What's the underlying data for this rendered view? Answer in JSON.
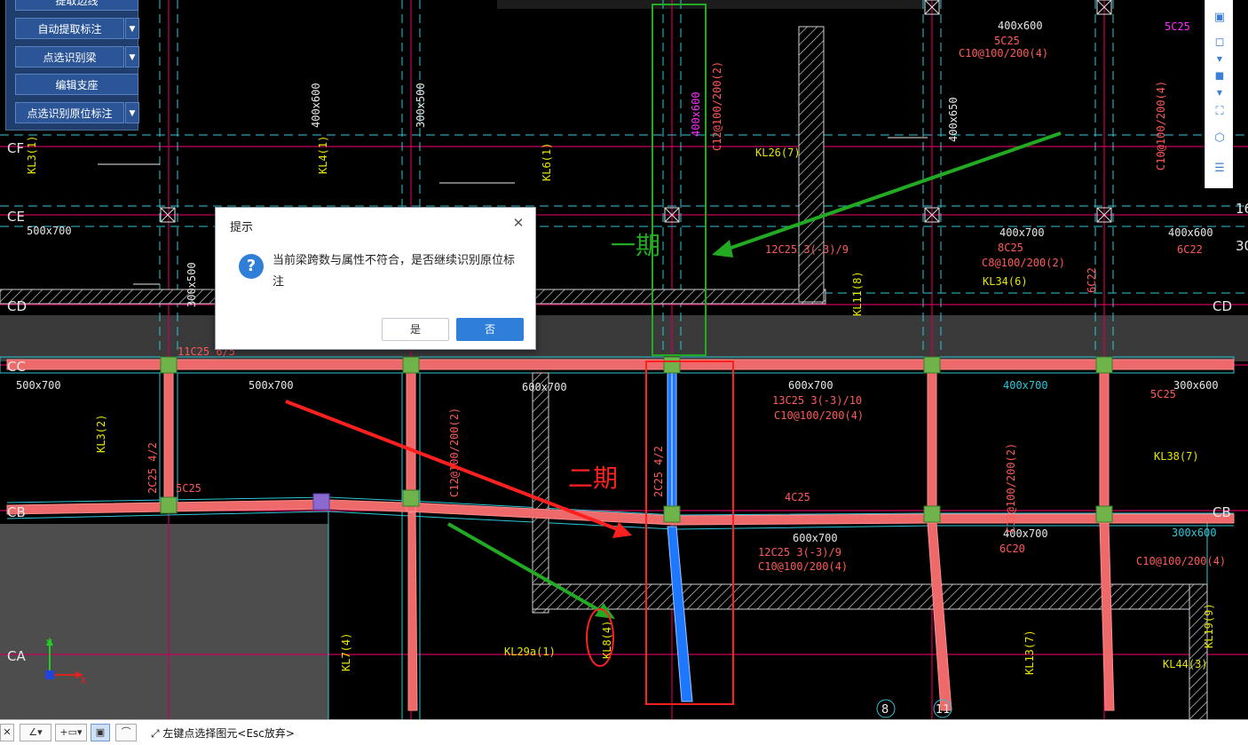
{
  "left_panel": {
    "buttons": [
      {
        "label": "提取边线",
        "has_dropdown": false
      },
      {
        "label": "自动提取标注",
        "has_dropdown": true
      },
      {
        "label": "点选识别梁",
        "has_dropdown": true
      },
      {
        "label": "编辑支座",
        "has_dropdown": false
      },
      {
        "label": "点选识别原位标注",
        "has_dropdown": true
      }
    ]
  },
  "dialog": {
    "title": "提示",
    "close_icon": "close-icon",
    "icon": "question-icon",
    "message": "当前梁跨数与属性不符合，是否继续识别原位标注",
    "yes_label": "是",
    "no_label": "否"
  },
  "annotations": {
    "phase1": "一期",
    "phase2": "二期"
  },
  "axes": {
    "rows": [
      "CF",
      "CE",
      "CD",
      "CC",
      "CB",
      "CA"
    ],
    "right_rows": [
      "CD",
      "CB"
    ],
    "columns": [
      "8",
      "11"
    ],
    "right_edge_marks": [
      "16",
      "30"
    ]
  },
  "drawing_labels": {
    "beam_tags": [
      "KL3(1)",
      "KL4(1)",
      "KL6(1)",
      "KL26(7)",
      "KL34(6)",
      "KL11(8)",
      "KL3(2)",
      "KL38(7)",
      "KL7(4)",
      "KL29a(1)",
      "KL8(4)",
      "KL13(7)",
      "KL44(3)",
      "KL19(9)"
    ],
    "sizes": [
      "400x600",
      "500x700",
      "300x500",
      "600x700",
      "400x700",
      "300x600",
      "400x650"
    ],
    "rebar": [
      "C10@100/200(4)",
      "C8@100/200(2)",
      "5C25",
      "8C25",
      "2C25 4/2",
      "6C22",
      "4C25",
      "6C20",
      "12C25 3(-3)/9",
      "13C25 3(-3)/10",
      "C12@100/200(2)",
      "11C25 6/5"
    ]
  },
  "ucs": {
    "x": "X",
    "y": "Y"
  },
  "right_toolbar": {
    "icons": [
      "view-3d-icon",
      "cube-icon",
      "cube-solid-icon",
      "fit-view-icon",
      "layers-cube-icon",
      "properties-icon"
    ]
  },
  "bottom_toolbar": {
    "status_text": "左键点选择图元<Esc放弃>",
    "icons": [
      "close-small-icon",
      "angle-icon",
      "dimension-icon",
      "screen-icon",
      "curve-icon",
      "expand-icon"
    ]
  },
  "colors": {
    "background": "#000000",
    "axis_line": "#c8005a",
    "grid_cyan": "#2ec7d9",
    "beam_fill": "#ee6a6a",
    "selected_beam": "#1e78ff",
    "annotation_green": "#22aa22",
    "annotation_red": "#ff2020",
    "text_yellow": "#e6e600",
    "text_white": "#e8e8e8",
    "text_magenta": "#ff2aff",
    "panel": "#1f3e6e",
    "dialog_button": "#2f7fd8"
  }
}
